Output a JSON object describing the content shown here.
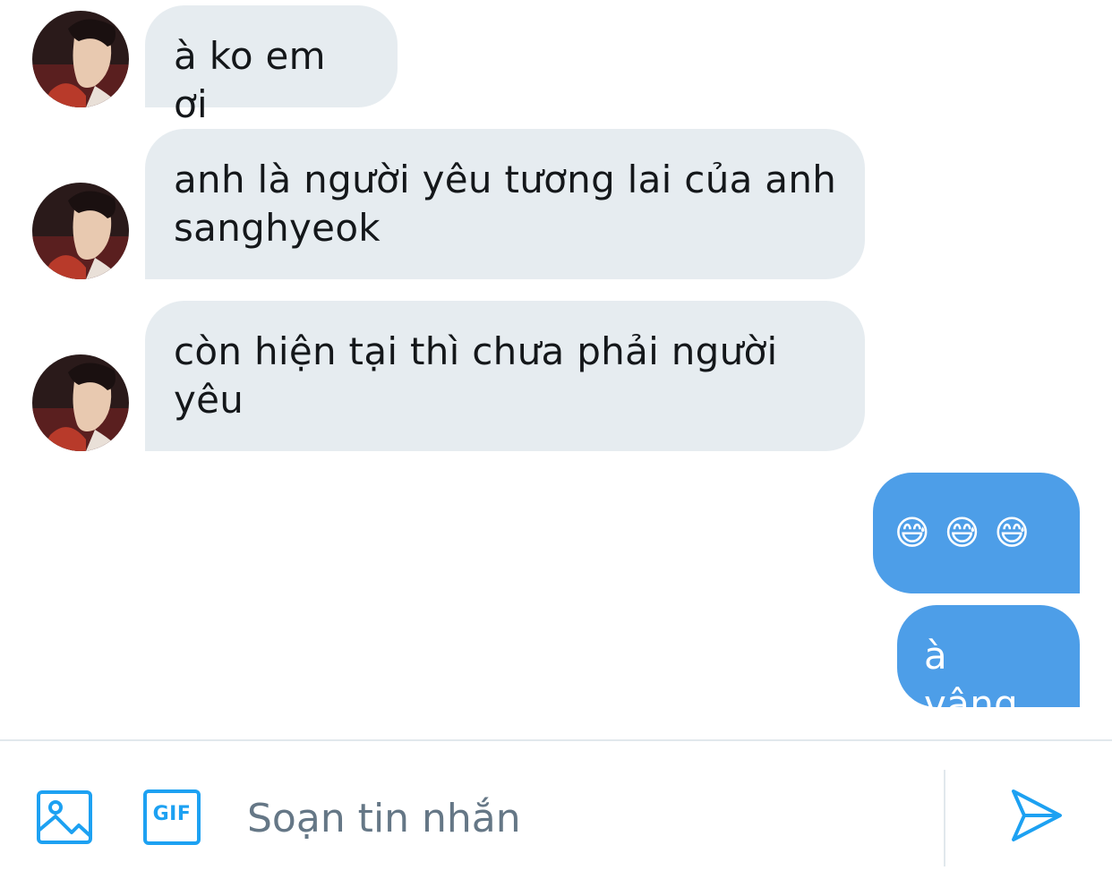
{
  "messages": [
    {
      "side": "received",
      "text": "à ko em ơi"
    },
    {
      "side": "received",
      "text": "anh là người yêu tương lai của anh sanghyeok"
    },
    {
      "side": "received",
      "text": "còn hiện tại thì chưa phải người yêu"
    },
    {
      "side": "sent",
      "text": "😅 😅 😅"
    },
    {
      "side": "sent",
      "text": "à vâng"
    }
  ],
  "composer": {
    "placeholder": "Soạn tin nhắn",
    "gif_label": "GIF",
    "icons": [
      "image-icon",
      "gif-icon",
      "send-icon"
    ]
  },
  "colors": {
    "received_bubble": "#e6ecf0",
    "sent_bubble": "#4d9ee8",
    "accent": "#1da1f2",
    "placeholder": "#657786"
  }
}
